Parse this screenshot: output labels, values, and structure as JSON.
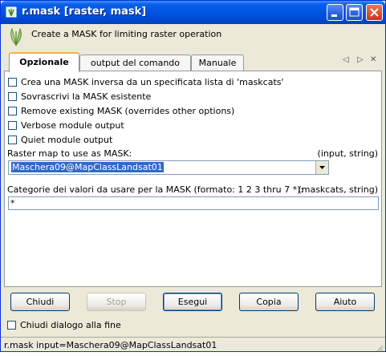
{
  "window": {
    "title": "r.mask [raster, mask]",
    "icon": "grass-app-icon",
    "controls": {
      "minimize": "minimize-icon",
      "maximize": "maximize-icon",
      "close": "close-icon"
    }
  },
  "header": {
    "icon": "grass-leaf-icon",
    "description": "Create a MASK for limiting raster operation"
  },
  "tabs": [
    {
      "label": "Opzionale",
      "active": true
    },
    {
      "label": "output del comando",
      "active": false
    },
    {
      "label": "Manuale",
      "active": false
    }
  ],
  "tab_nav": {
    "prev": "◁",
    "next": "▷",
    "close": "✕"
  },
  "options": {
    "checkboxes": [
      {
        "label": "Crea una MASK inversa da un specificata lista di 'maskcats'",
        "checked": false
      },
      {
        "label": "Sovrascrivi la MASK esistente",
        "checked": false
      },
      {
        "label": "Remove existing MASK (overrides other options)",
        "checked": false
      },
      {
        "label": "Verbose module output",
        "checked": false
      },
      {
        "label": "Quiet module output",
        "checked": false
      }
    ],
    "raster_label": "Raster map to use as MASK:",
    "raster_hint": "(input, string)",
    "raster_value": "Maschera09@MapClassLandsat01",
    "maskcats_label": "Categorie dei valori da usare per la MASK (formato: 1 2 3 thru 7 *):",
    "maskcats_hint": "(maskcats, string)",
    "maskcats_value": "*"
  },
  "buttons": [
    {
      "label": "Chiudi",
      "enabled": true
    },
    {
      "label": "Stop",
      "enabled": false
    },
    {
      "label": "Esegui",
      "enabled": true
    },
    {
      "label": "Copia",
      "enabled": true
    },
    {
      "label": "Aiuto",
      "enabled": true
    }
  ],
  "close_on_finish": {
    "label": "Chiudi dialogo alla fine",
    "checked": false
  },
  "status": {
    "command": "r.mask input=Maschera09@MapClassLandsat01"
  },
  "colors": {
    "title_bar": "#0054e3",
    "selection": "#316ac5",
    "active_tab_accent": "#f4b436"
  }
}
